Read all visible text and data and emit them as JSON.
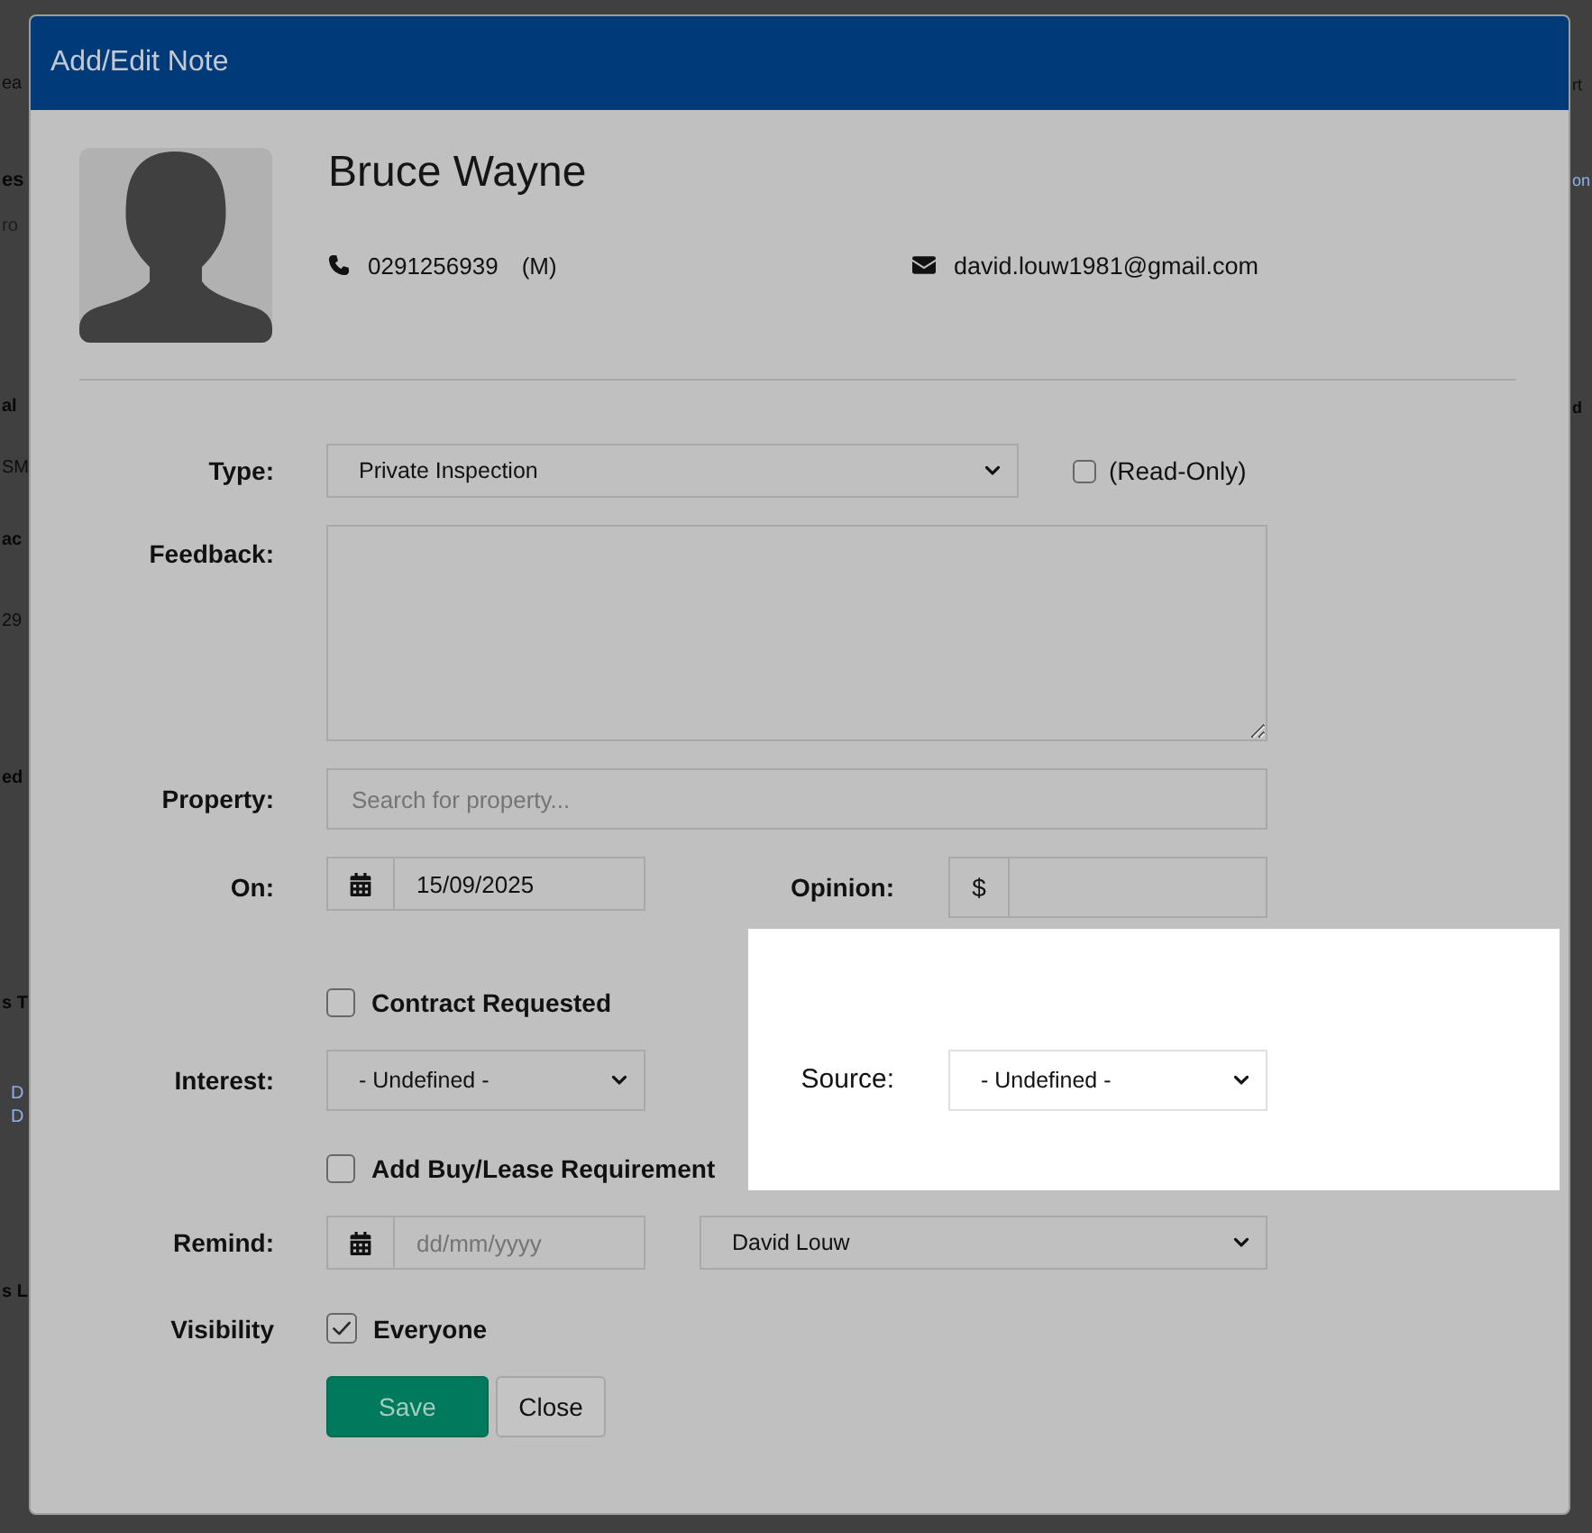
{
  "background_page": {
    "left_edge": [
      {
        "text": "ea",
        "kind": "plain"
      },
      {
        "text": "es",
        "kind": "heading"
      },
      {
        "text": "ro",
        "kind": "muted"
      },
      {
        "text": "al",
        "kind": "strong"
      },
      {
        "text": "SM",
        "kind": "plain"
      },
      {
        "text": "ac",
        "kind": "strong"
      },
      {
        "text": "29",
        "kind": "plain"
      },
      {
        "text": "ed",
        "kind": "strong"
      },
      {
        "text": "s T",
        "kind": "strong"
      },
      {
        "text": "D",
        "kind": "link"
      },
      {
        "text": "D",
        "kind": "link"
      },
      {
        "text": "s L",
        "kind": "strong"
      }
    ],
    "right_edge": [
      {
        "text": "rt",
        "kind": "plain"
      },
      {
        "text": "on",
        "kind": "link"
      },
      {
        "text": "d",
        "kind": "strong"
      }
    ]
  },
  "dialog": {
    "title": "Add/Edit Note"
  },
  "contact": {
    "name": "Bruce Wayne",
    "phone": "0291256939",
    "phone_type": "(M)",
    "email": "david.louw1981@gmail.com"
  },
  "form": {
    "type": {
      "label": "Type:",
      "value": "Private Inspection",
      "read_only": {
        "label": "(Read-Only)",
        "checked": false
      }
    },
    "feedback": {
      "label": "Feedback:"
    },
    "property": {
      "label": "Property:",
      "placeholder": "Search for property..."
    },
    "on": {
      "label": "On:",
      "value": "15/09/2025"
    },
    "opinion": {
      "label": "Opinion:",
      "prefix": "$"
    },
    "contract_requested": {
      "label": "Contract Requested",
      "checked": false
    },
    "interest": {
      "label": "Interest:",
      "value": "- Undefined -"
    },
    "source": {
      "label": "Source:",
      "value": "- Undefined -",
      "highlighted": true
    },
    "buy_lease": {
      "label": "Add Buy/Lease Requirement",
      "checked": false
    },
    "remind": {
      "label": "Remind:",
      "placeholder": "dd/mm/yyyy",
      "assignee": "David Louw"
    },
    "visibility": {
      "label": "Visibility",
      "option": {
        "label": "Everyone",
        "checked": true
      }
    }
  },
  "buttons": [
    {
      "label": "Save",
      "kind": "primary"
    },
    {
      "label": "Close",
      "kind": "secondary"
    }
  ]
}
